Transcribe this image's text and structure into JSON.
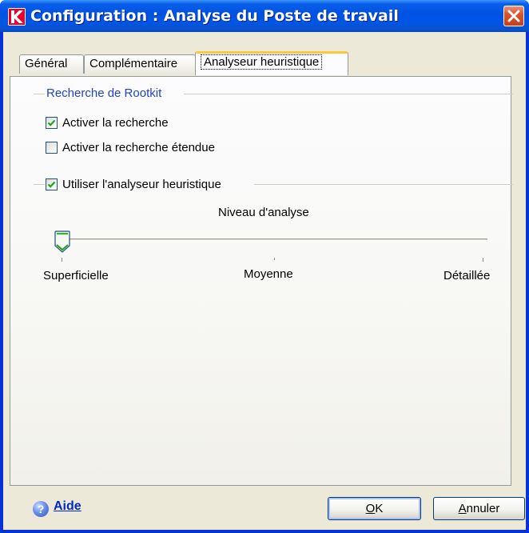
{
  "window": {
    "title": "Configuration : Analyse du Poste de travail",
    "close_icon": "close-icon",
    "app_icon": "kaspersky-k-icon"
  },
  "tabs": [
    {
      "label": "Général",
      "active": false
    },
    {
      "label": "Complémentaire",
      "active": false
    },
    {
      "label": "Analyseur heuristique",
      "active": true
    }
  ],
  "rootkit_group": {
    "title": "Recherche de Rootkit",
    "options": [
      {
        "label": "Activer la recherche",
        "checked": true
      },
      {
        "label": "Activer la recherche étendue",
        "checked": false
      }
    ]
  },
  "heuristic": {
    "label": "Utiliser l'analyseur heuristique",
    "checked": true,
    "level_title": "Niveau d'analyse",
    "level_labels": [
      "Superficielle",
      "Moyenne",
      "Détaillée"
    ],
    "selected_level": "Superficielle"
  },
  "footer": {
    "help_label": "Aide",
    "ok_accel": "O",
    "ok_rest": "K",
    "cancel_accel": "A",
    "cancel_rest": "nnuler"
  },
  "colors": {
    "accent": "#0831D9",
    "group_title": "#2143C4",
    "active_tab": "#FFC83C"
  }
}
